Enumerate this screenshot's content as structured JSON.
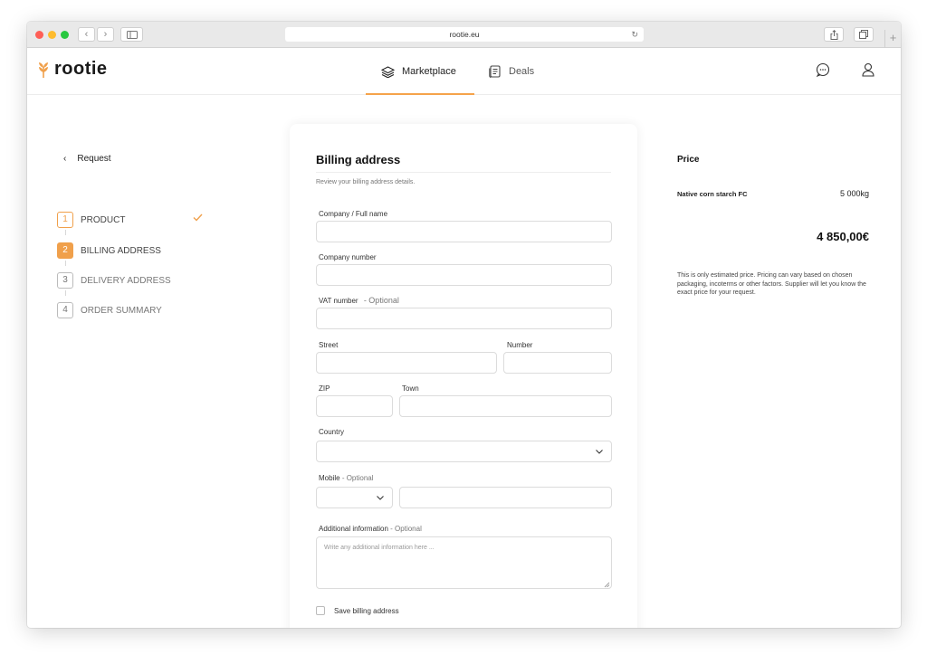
{
  "browser": {
    "url": "rootie.eu",
    "back_glyph": "‹",
    "forward_glyph": "›",
    "new_tab_glyph": "+",
    "reload_glyph": "↻"
  },
  "header": {
    "logo_text": "rootie",
    "nav": [
      {
        "label": "Marketplace",
        "icon": "layers-icon",
        "active": true
      },
      {
        "label": "Deals",
        "icon": "document-icon",
        "active": false
      }
    ],
    "accent_color": "#f5a34a"
  },
  "sidebar": {
    "back_label": "Request",
    "steps": [
      {
        "num": "1",
        "label": "PRODUCT",
        "state": "done"
      },
      {
        "num": "2",
        "label": "BILLING ADDRESS",
        "state": "active"
      },
      {
        "num": "3",
        "label": "DELIVERY ADDRESS",
        "state": "pending"
      },
      {
        "num": "4",
        "label": "ORDER SUMMARY",
        "state": "pending"
      }
    ]
  },
  "form": {
    "title": "Billing address",
    "subtitle": "Review your billing address details.",
    "company_label": "Company / Full name",
    "company_value": "",
    "company_number_label": "Company number",
    "company_number_value": "",
    "vat_label": "VAT number",
    "vat_optional": "- Optional",
    "vat_value": "",
    "street_label": "Street",
    "street_value": "",
    "number_label": "Number",
    "number_value": "",
    "zip_label": "ZIP",
    "zip_value": "",
    "town_label": "Town",
    "town_value": "",
    "country_label": "Country",
    "country_value": "",
    "mobile_label": "Mobile",
    "mobile_optional": "- Optional",
    "mobile_value": "",
    "additional_label": "Additional information",
    "additional_optional": "- Optional",
    "additional_placeholder": "Write any additional information here ...",
    "save_label": "Save billing address",
    "save_checked": false
  },
  "price": {
    "title": "Price",
    "item_name": "Native corn starch FC",
    "item_qty": "5 000kg",
    "total": "4 850,00€",
    "note": "This is only estimated price. Pricing can vary based on chosen packaging, incoterms or other factors. Supplier will let you know the exact price for your request."
  }
}
